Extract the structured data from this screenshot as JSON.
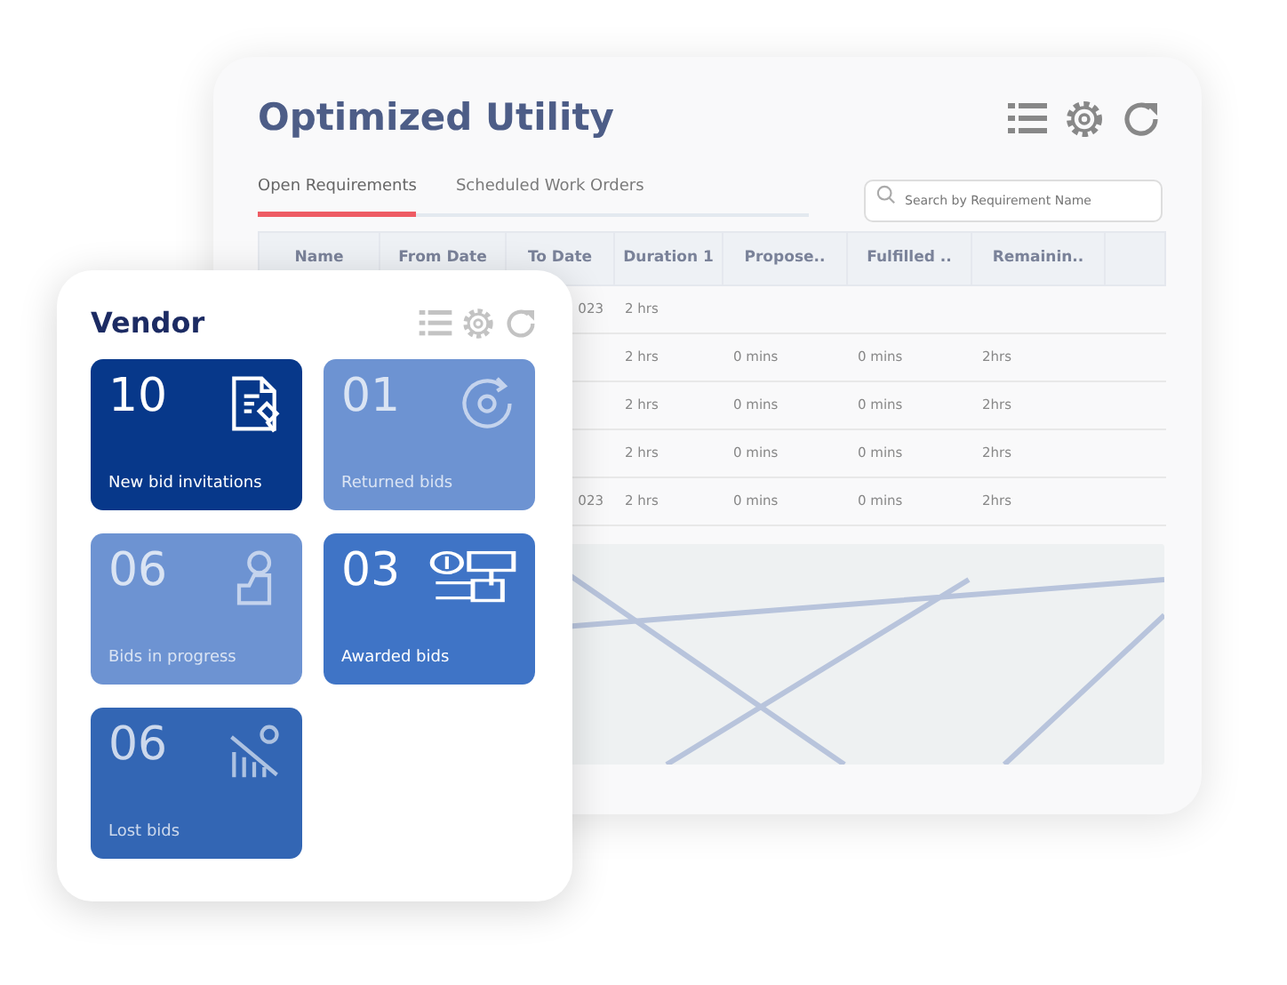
{
  "back_window": {
    "title": "Optimized Utility",
    "tabs": [
      {
        "label": "Open Requirements",
        "selected": true
      },
      {
        "label": "Scheduled Work Orders",
        "selected": false
      }
    ],
    "search": {
      "placeholder": "Search by Requirement Name"
    },
    "table": {
      "columns": [
        "Name",
        "From Date",
        "To Date",
        "Duration 1",
        "Propose..",
        "Fulfilled ..",
        "Remainin..",
        ""
      ],
      "rows": [
        {
          "cells": [
            "",
            "",
            "023",
            "2 hrs",
            "",
            "",
            "",
            ""
          ]
        },
        {
          "cells": [
            "",
            "",
            "",
            "2 hrs",
            "0 mins",
            "0 mins",
            "2hrs",
            ""
          ]
        },
        {
          "cells": [
            "",
            "",
            "",
            "2 hrs",
            "0 mins",
            "0 mins",
            "2hrs",
            ""
          ]
        },
        {
          "cells": [
            "",
            "",
            "",
            "2 hrs",
            "0 mins",
            "0 mins",
            "2hrs",
            ""
          ]
        },
        {
          "cells": [
            "",
            "",
            "023",
            "2 hrs",
            "0 mins",
            "0 mins",
            "2hrs",
            ""
          ]
        }
      ]
    }
  },
  "vendor_card": {
    "title": "Vendor",
    "tiles": [
      {
        "count": "10",
        "label": "New bid invitations",
        "kind": "invitation",
        "color": "#07388a",
        "blurred": false
      },
      {
        "count": "01",
        "label": "Returned bids",
        "kind": "returned",
        "color": "#6d93d2",
        "blurred": true
      },
      {
        "count": "06",
        "label": "Bids in progress",
        "kind": "progress",
        "color": "#6d93d2",
        "blurred": true
      },
      {
        "count": "03",
        "label": "Awarded bids",
        "kind": "awarded",
        "color": "#3f74c6",
        "blurred": false
      },
      {
        "count": "06",
        "label": "Lost bids",
        "kind": "lost",
        "color": "#3366b4",
        "blurred": true
      }
    ]
  }
}
